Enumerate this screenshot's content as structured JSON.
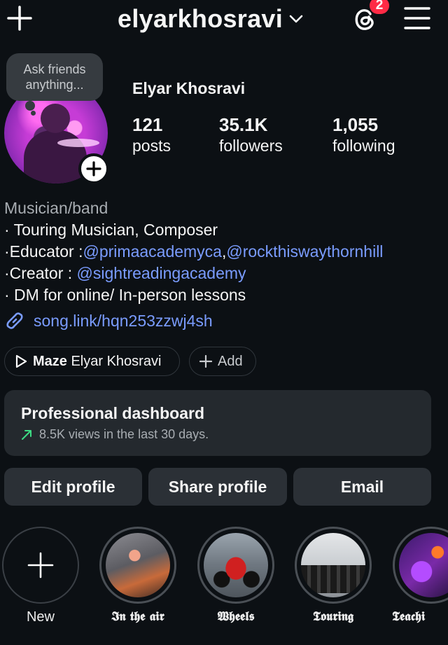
{
  "header": {
    "username": "elyarkhosravi",
    "threads_badge": "2"
  },
  "profile": {
    "note_bubble": "Ask friends anything...",
    "full_name": "Elyar Khosravi",
    "stats": [
      {
        "value": "121",
        "label": "posts"
      },
      {
        "value": "35.1K",
        "label": "followers"
      },
      {
        "value": "1,055",
        "label": "following"
      }
    ]
  },
  "bio": {
    "category": "Musician/band",
    "line1": "· Touring Musician, Composer",
    "line2_prefix": "·Educator :",
    "line2_mention1": "@primaacademyca",
    "line2_sep": ",",
    "line2_mention2": "@rockthiswaythornhill",
    "line3_prefix": "·Creator : ",
    "line3_mention": "@sightreadingacademy",
    "line4": "· DM for online/ In-person lessons",
    "link": "song.link/hqn253zzwj4sh"
  },
  "chips": {
    "maze_bold": "Maze",
    "maze_name": "Elyar Khosravi",
    "add_label": "Add"
  },
  "dashboard": {
    "title": "Professional dashboard",
    "subtitle": "8.5K views in the last 30 days."
  },
  "buttons": {
    "edit": "Edit profile",
    "share": "Share profile",
    "email": "Email"
  },
  "highlights": [
    {
      "label": "New"
    },
    {
      "label": "𝕴𝖓 𝖙𝖍𝖊 𝖆𝖎𝖗"
    },
    {
      "label": "𝖂𝖍𝖊𝖊𝖑𝖘"
    },
    {
      "label": "𝕿𝖔𝖚𝖗𝖎𝖓𝖌"
    },
    {
      "label": "𝕿𝖊𝖆𝖈𝖍𝖎"
    }
  ],
  "colors": {
    "background": "#0c1014",
    "mention": "#7a9cff",
    "badge": "#ff2a45",
    "trend_up": "#3ddc84"
  }
}
